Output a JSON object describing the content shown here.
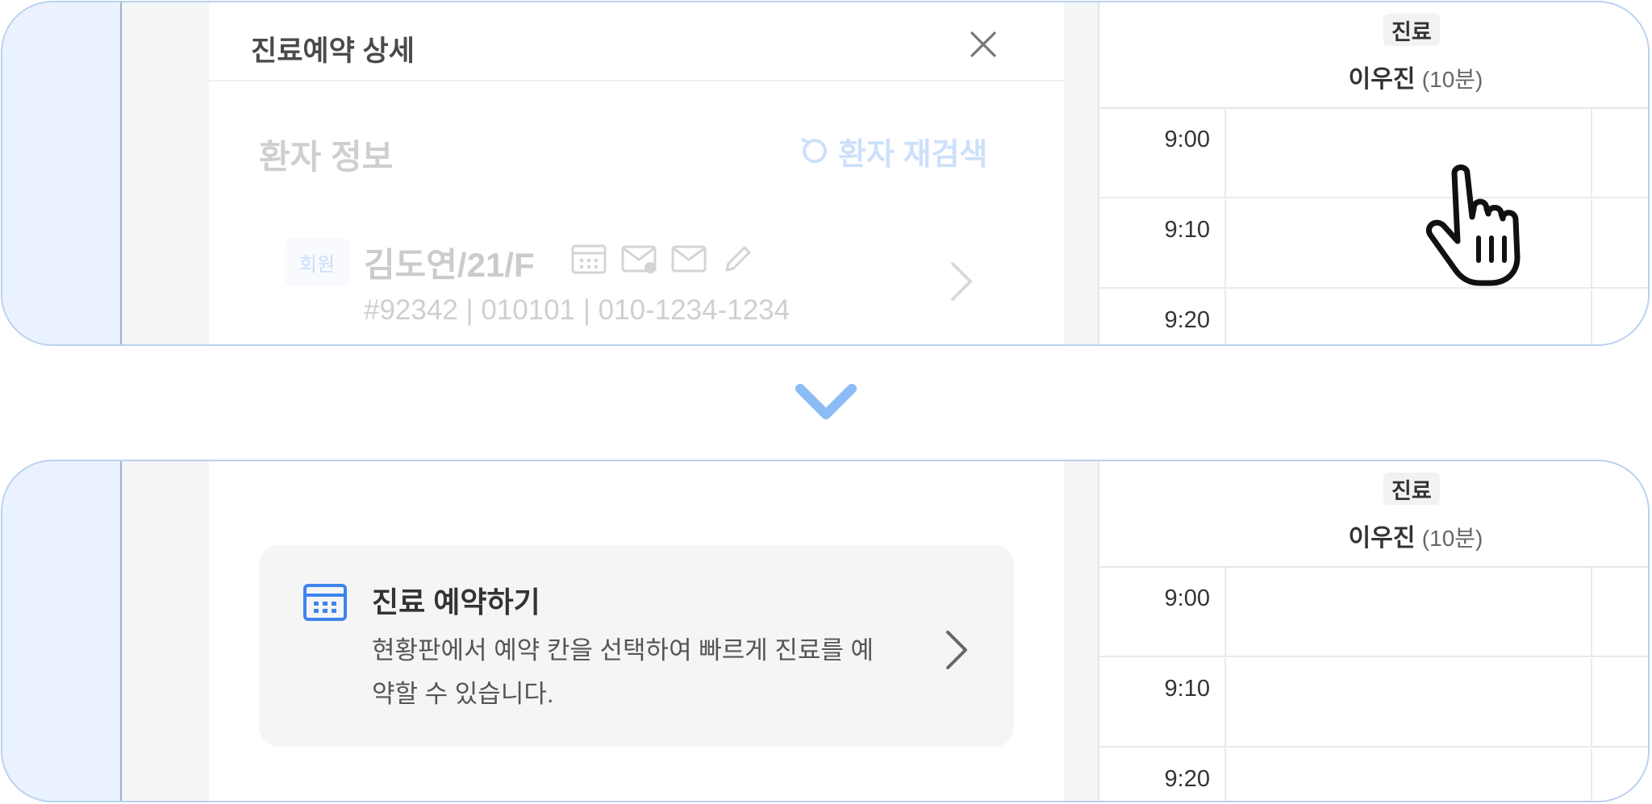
{
  "top": {
    "modal": {
      "title": "진료예약 상세"
    },
    "patient": {
      "section_title": "환자 정보",
      "research_label": "환자 재검색",
      "member_badge": "회원",
      "name_line": "김도연/21/F",
      "info_line": "#92342 | 010101 | 010-1234-1234"
    },
    "schedule": {
      "tag": "진료",
      "doctor": "이우진",
      "duration": "(10분)",
      "slots": [
        "9:00",
        "9:10",
        "9:20"
      ]
    }
  },
  "bottom": {
    "card": {
      "title": "진료 예약하기",
      "description": "현황판에서 예약 칸을 선택하여 빠르게 진료를 예약할 수 있습니다."
    },
    "schedule": {
      "tag": "진료",
      "doctor": "이우진",
      "duration": "(10분)",
      "slots": [
        "9:00",
        "9:10",
        "9:20"
      ]
    }
  },
  "colors": {
    "accent": "#3d84ee",
    "frame": "#b9d1ee",
    "arrow": "#8bbcf5"
  },
  "icons": [
    "close-icon",
    "refresh-icon",
    "calendar-icon",
    "mail-check-icon",
    "mail-icon",
    "pencil-icon",
    "chevron-right-icon",
    "pointer-hand-icon",
    "chevron-down-icon"
  ]
}
